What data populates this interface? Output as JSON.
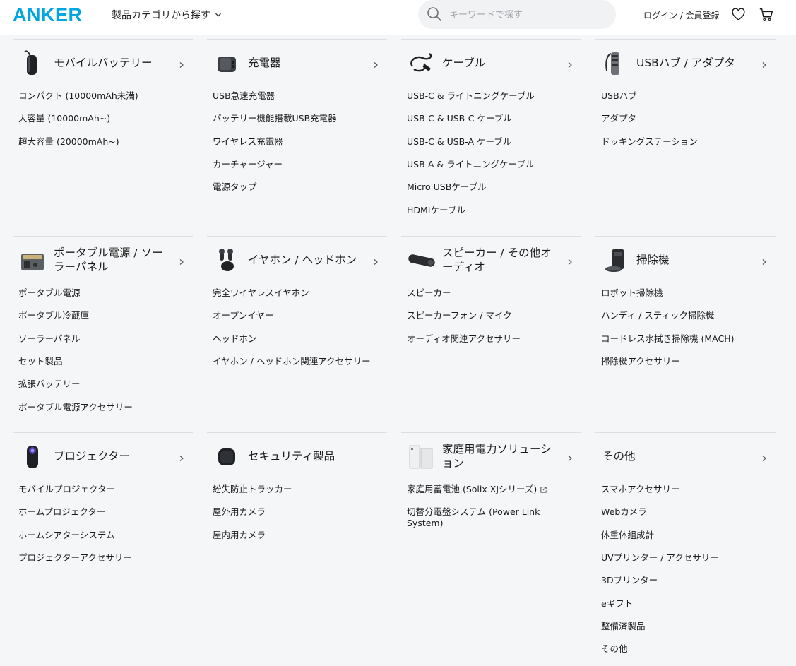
{
  "header": {
    "logo": "ANKER",
    "category_menu_label": "製品カテゴリから探す",
    "search_placeholder": "キーワードで探す",
    "login_label": "ログイン / 会員登録"
  },
  "colors": {
    "brand": "#00a7e1",
    "page_bg": "#f5f6f8",
    "divider": "#dcdee2"
  },
  "categories": [
    {
      "title": "モバイルバッテリー",
      "icon": "power-bank-icon",
      "has_chevron": true,
      "links": [
        "コンパクト (10000mAh未満)",
        "大容量 (10000mAh~)",
        "超大容量 (20000mAh~)"
      ]
    },
    {
      "title": "充電器",
      "icon": "charger-icon",
      "has_chevron": true,
      "links": [
        "USB急速充電器",
        "バッテリー機能搭載USB充電器",
        "ワイヤレス充電器",
        "カーチャージャー",
        "電源タップ"
      ]
    },
    {
      "title": "ケーブル",
      "icon": "cable-icon",
      "has_chevron": true,
      "links": [
        "USB-C & ライトニングケーブル",
        "USB-C & USB-C ケーブル",
        "USB-C & USB-A ケーブル",
        "USB-A & ライトニングケーブル",
        "Micro USBケーブル",
        "HDMIケーブル"
      ]
    },
    {
      "title": "USBハブ / アダプタ",
      "icon": "usb-hub-icon",
      "has_chevron": true,
      "links": [
        "USBハブ",
        "アダプタ",
        "ドッキングステーション"
      ]
    },
    {
      "title": "ポータブル電源 / ソーラーパネル",
      "icon": "portable-power-icon",
      "has_chevron": true,
      "links": [
        "ポータブル電源",
        "ポータブル冷蔵庫",
        "ソーラーパネル",
        "セット製品",
        "拡張バッテリー",
        "ポータブル電源アクセサリー"
      ]
    },
    {
      "title": "イヤホン / ヘッドホン",
      "icon": "earbuds-icon",
      "has_chevron": true,
      "links": [
        "完全ワイヤレスイヤホン",
        "オープンイヤー",
        "ヘッドホン",
        "イヤホン / ヘッドホン関連アクセサリー"
      ]
    },
    {
      "title": "スピーカー / その他オーディオ",
      "icon": "speaker-icon",
      "has_chevron": true,
      "links": [
        "スピーカー",
        "スピーカーフォン / マイク",
        "オーディオ関連アクセサリー"
      ]
    },
    {
      "title": "掃除機",
      "icon": "robot-vacuum-icon",
      "has_chevron": true,
      "links": [
        "ロボット掃除機",
        "ハンディ / スティック掃除機",
        "コードレス水拭き掃除機 (MACH)",
        "掃除機アクセサリー"
      ]
    },
    {
      "title": "プロジェクター",
      "icon": "projector-icon",
      "has_chevron": true,
      "links": [
        "モバイルプロジェクター",
        "ホームプロジェクター",
        "ホームシアターシステム",
        "プロジェクターアクセサリー"
      ]
    },
    {
      "title": "セキュリティ製品",
      "icon": "tracker-icon",
      "has_chevron": false,
      "links": [
        "紛失防止トラッカー",
        "屋外用カメラ",
        "屋内用カメラ"
      ]
    },
    {
      "title": "家庭用電力ソリューション",
      "icon": "home-battery-icon",
      "has_chevron": true,
      "links": [
        "家庭用蓄電池 (Solix XJシリーズ)",
        "切替分電盤システム (Power Link System)"
      ]
    },
    {
      "title": "その他",
      "icon": "",
      "has_chevron": true,
      "links": [
        "スマホアクセサリー",
        "Webカメラ",
        "体重体組成計",
        "UVプリンター / アクセサリー",
        "3Dプリンター",
        "eギフト",
        "整備済製品",
        "その他"
      ]
    }
  ]
}
